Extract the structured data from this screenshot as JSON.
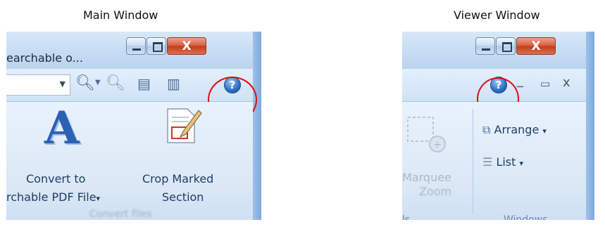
{
  "captions": {
    "main": "Main Window",
    "viewer": "Viewer Window"
  },
  "main_window": {
    "title_fragment": "earchable o...",
    "caption_buttons": {
      "minimize": "",
      "maximize": "",
      "close": "X"
    },
    "help_icon": "?",
    "ribbon": {
      "convert_button": {
        "line1": "Convert to",
        "line2": "rchable PDF File",
        "arrow": "▾"
      },
      "crop_button": {
        "line1": "Crop Marked",
        "line2": "Section"
      },
      "group_label": "Convert files"
    }
  },
  "viewer_window": {
    "caption_buttons": {
      "minimize": "",
      "maximize": "",
      "close": "X"
    },
    "help_icon": "?",
    "mdi_controls": {
      "minimize": "_",
      "restore": "▭",
      "close": "x"
    },
    "ribbon": {
      "marquee_zoom": {
        "line1": "Marquee",
        "line2": "Zoom"
      },
      "left_group_fragment": "ls",
      "arrange_button": {
        "label": "Arrange",
        "arrow": "▾"
      },
      "list_button": {
        "label": "List",
        "arrow": "▾"
      },
      "group_label": "Windows"
    }
  },
  "colors": {
    "highlight_ring": "#e20b0b",
    "ribbon_text": "#1f3d66",
    "help_blue": "#2b6fc2"
  }
}
